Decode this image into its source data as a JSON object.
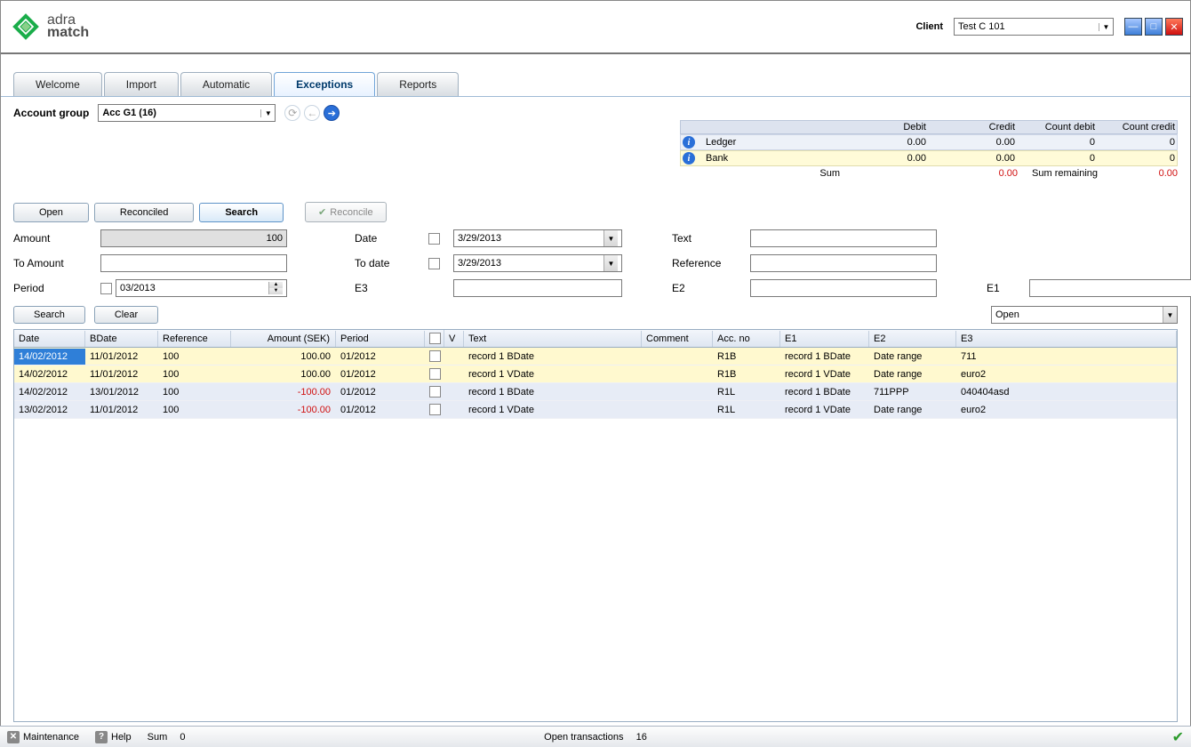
{
  "header": {
    "brand_top": "adra",
    "brand_bot": "match",
    "client_label": "Client",
    "client_value": "Test C 101"
  },
  "tabs": {
    "welcome": "Welcome",
    "import": "Import",
    "automatic": "Automatic",
    "exceptions": "Exceptions",
    "reports": "Reports"
  },
  "account_group": {
    "label": "Account group",
    "value": "Acc G1 (16)"
  },
  "summary": {
    "cols": {
      "debit": "Debit",
      "credit": "Credit",
      "cdebit": "Count debit",
      "ccredit": "Count credit"
    },
    "ledger": {
      "name": "Ledger",
      "debit": "0.00",
      "credit": "0.00",
      "cdebit": "0",
      "ccredit": "0"
    },
    "bank": {
      "name": "Bank",
      "debit": "0.00",
      "credit": "0.00",
      "cdebit": "0",
      "ccredit": "0"
    },
    "sum_label": "Sum",
    "sum_val": "0.00",
    "sum_remaining_label": "Sum remaining",
    "sum_remaining_val": "0.00"
  },
  "filter_tabs": {
    "open": "Open",
    "reconciled": "Reconciled",
    "search": "Search",
    "reconcile": "Reconcile"
  },
  "form": {
    "amount_label": "Amount",
    "amount_value": "100",
    "to_amount_label": "To Amount",
    "period_label": "Period",
    "period_value": "03/2013",
    "date_label": "Date",
    "date_value": "3/29/2013",
    "to_date_label": "To date",
    "to_date_value": "3/29/2013",
    "e3_label": "E3",
    "text_label": "Text",
    "reference_label": "Reference",
    "e2_label": "E2",
    "e1_label": "E1"
  },
  "actions": {
    "search": "Search",
    "clear": "Clear",
    "view": "Open"
  },
  "grid": {
    "cols": {
      "date": "Date",
      "bdate": "BDate",
      "reference": "Reference",
      "amount": "Amount (SEK)",
      "period": "Period",
      "v": "V",
      "text": "Text",
      "comment": "Comment",
      "accno": "Acc. no",
      "e1": "E1",
      "e2": "E2",
      "e3": "E3"
    },
    "rows": [
      {
        "date": "14/02/2012",
        "bdate": "11/01/2012",
        "ref": "100",
        "amount": "100.00",
        "neg": false,
        "period": "01/2012",
        "text": "record 1 BDate",
        "accno": "R1B",
        "e1": "record 1 BDate",
        "e2": "Date range",
        "e3": "711",
        "cls": "y",
        "sel": true
      },
      {
        "date": "14/02/2012",
        "bdate": "11/01/2012",
        "ref": "100",
        "amount": "100.00",
        "neg": false,
        "period": "01/2012",
        "text": "record 1 VDate",
        "accno": "R1B",
        "e1": "record 1 VDate",
        "e2": "Date range",
        "e3": "euro2",
        "cls": "y",
        "sel": false
      },
      {
        "date": "14/02/2012",
        "bdate": "13/01/2012",
        "ref": "100",
        "amount": "-100.00",
        "neg": true,
        "period": "01/2012",
        "text": "record 1 BDate",
        "accno": "R1L",
        "e1": "record 1 BDate",
        "e2": "711PPP",
        "e3": "040404asd",
        "cls": "b",
        "sel": false
      },
      {
        "date": "13/02/2012",
        "bdate": "11/01/2012",
        "ref": "100",
        "amount": "-100.00",
        "neg": true,
        "period": "01/2012",
        "text": "record 1 VDate",
        "accno": "R1L",
        "e1": "record 1 VDate",
        "e2": "Date range",
        "e3": "euro2",
        "cls": "b",
        "sel": false
      }
    ]
  },
  "status": {
    "maintenance": "Maintenance",
    "help": "Help",
    "sum_label": "Sum",
    "sum_val": "0",
    "open_trans_label": "Open transactions",
    "open_trans_val": "16"
  }
}
